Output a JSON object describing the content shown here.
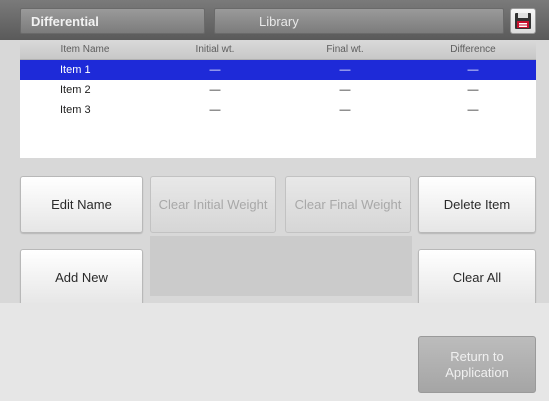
{
  "tabs": {
    "differential": "Differential",
    "library": "Library"
  },
  "icons": {
    "save": "floppy-disk-icon"
  },
  "table": {
    "headers": [
      "Item Name",
      "Initial wt.",
      "Final wt.",
      "Difference"
    ],
    "rows": [
      {
        "name": "Item 1",
        "initial": "—",
        "final": "—",
        "difference": "—",
        "selected": true
      },
      {
        "name": "Item 2",
        "initial": "—",
        "final": "—",
        "difference": "—",
        "selected": false
      },
      {
        "name": "Item 3",
        "initial": "—",
        "final": "—",
        "difference": "—",
        "selected": false
      }
    ]
  },
  "buttons": {
    "edit_name": "Edit Name",
    "clear_initial": "Clear Initial Weight",
    "clear_final": "Clear Final Weight",
    "delete_item": "Delete Item",
    "add_new": "Add New",
    "clear_all": "Clear All",
    "return": "Return to Application"
  },
  "colors": {
    "selected_row": "#1e2ad8",
    "topbar": "#6a6a6a"
  }
}
